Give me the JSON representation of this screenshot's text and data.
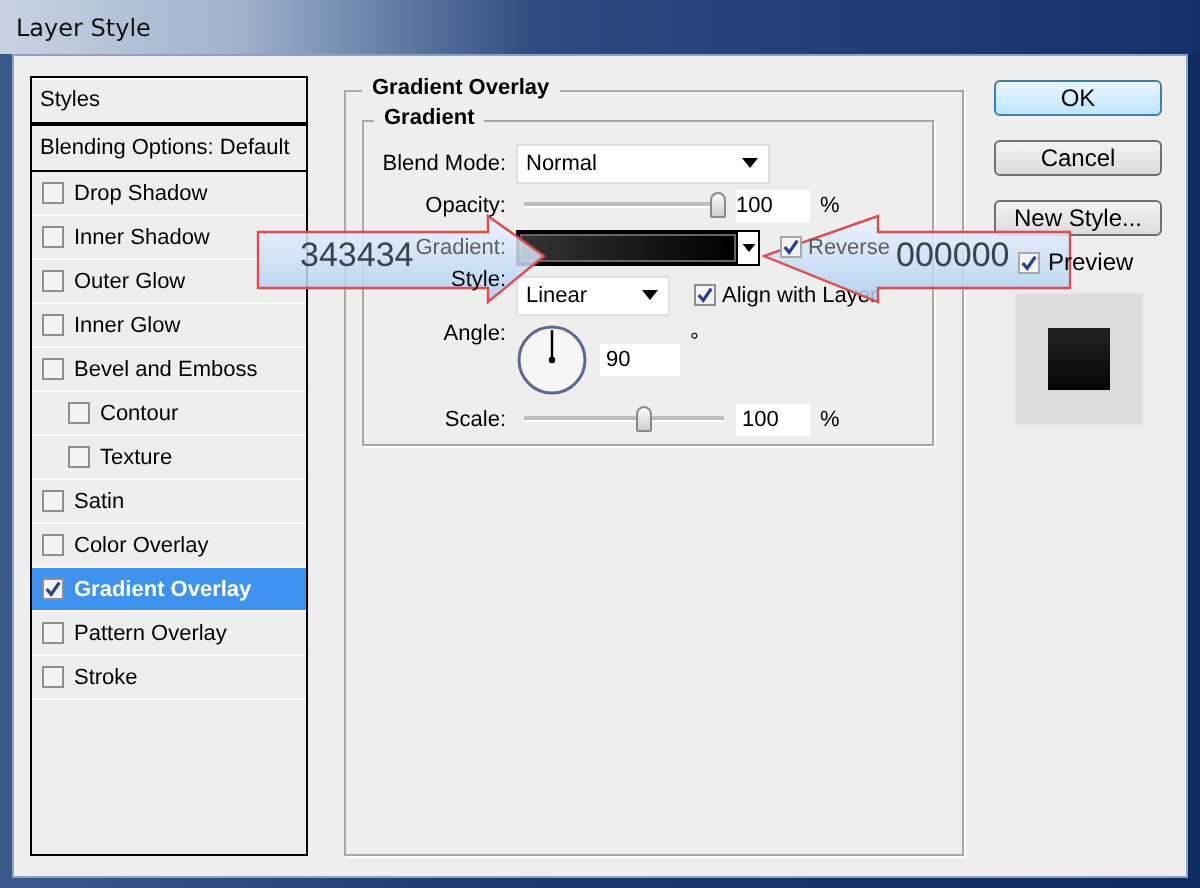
{
  "window": {
    "title": "Layer Style"
  },
  "styles_panel": {
    "header": "Styles",
    "items": [
      {
        "label": "Blending Options: Default",
        "kind": "header",
        "selected": false
      },
      {
        "label": "Drop Shadow",
        "kind": "option",
        "checked": false,
        "selected": false
      },
      {
        "label": "Inner Shadow",
        "kind": "option",
        "checked": false,
        "selected": false
      },
      {
        "label": "Outer Glow",
        "kind": "option",
        "checked": false,
        "selected": false
      },
      {
        "label": "Inner Glow",
        "kind": "option",
        "checked": false,
        "selected": false
      },
      {
        "label": "Bevel and Emboss",
        "kind": "option",
        "checked": false,
        "selected": false,
        "children": [
          {
            "label": "Contour",
            "kind": "option",
            "checked": false,
            "selected": false
          },
          {
            "label": "Texture",
            "kind": "option",
            "checked": false,
            "selected": false
          }
        ]
      },
      {
        "label": "Satin",
        "kind": "option",
        "checked": false,
        "selected": false
      },
      {
        "label": "Color Overlay",
        "kind": "option",
        "checked": false,
        "selected": false
      },
      {
        "label": "Gradient Overlay",
        "kind": "option",
        "checked": true,
        "selected": true
      },
      {
        "label": "Pattern Overlay",
        "kind": "option",
        "checked": false,
        "selected": false
      },
      {
        "label": "Stroke",
        "kind": "option",
        "checked": false,
        "selected": false
      }
    ]
  },
  "options": {
    "title": "Gradient Overlay",
    "group": "Gradient",
    "blend_mode": {
      "label": "Blend Mode:",
      "value": "Normal"
    },
    "opacity": {
      "label": "Opacity:",
      "level": 0.97,
      "value": "100",
      "unit": "%"
    },
    "gradient": {
      "label": "Gradient:",
      "reverse_label": "Reverse",
      "reverse_checked": true
    },
    "style": {
      "label": "Style:",
      "value": "Linear",
      "align_label": "Align with Layer",
      "align_checked": true
    },
    "angle": {
      "label": "Angle:",
      "value": "90",
      "unit": "°"
    },
    "scale": {
      "label": "Scale:",
      "level": 0.6,
      "value": "100",
      "unit": "%"
    }
  },
  "buttons": [
    {
      "label": "OK",
      "default": true
    },
    {
      "label": "Cancel",
      "default": false
    },
    {
      "label": "New Style...",
      "default": false
    }
  ],
  "preview": {
    "label": "Preview",
    "checked": true
  },
  "callouts": [
    {
      "text": "343434",
      "kind": "right"
    },
    {
      "text": "000000",
      "kind": "left"
    }
  ]
}
